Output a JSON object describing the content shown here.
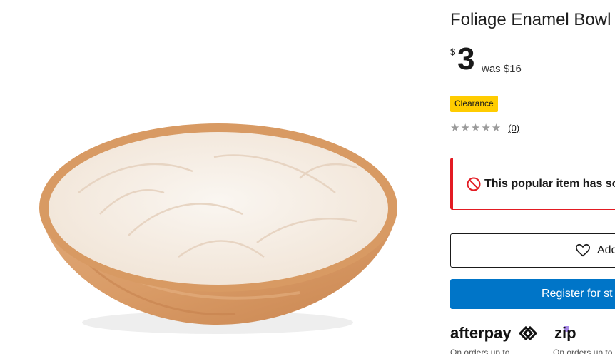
{
  "product": {
    "title": "Foliage Enamel Bowl",
    "image_alt": "product-image-foliage-enamel-bowl"
  },
  "price": {
    "currency": "$",
    "amount": "3",
    "was": "was $16"
  },
  "badge": {
    "label": "Clearance",
    "color": "#ffcc00"
  },
  "rating": {
    "stars": "★★★★★",
    "count": "(0)"
  },
  "alert": {
    "icon": "prohibited-icon",
    "text": "This popular item has so",
    "color": "#e31b23"
  },
  "wishlist": {
    "icon": "heart-icon",
    "label": "Add"
  },
  "register": {
    "label": "Register for st",
    "color": "#0075c8"
  },
  "payments": {
    "afterpay": {
      "logo_text": "afterpay",
      "note": "On orders up to"
    },
    "zip": {
      "logo_text": "zip",
      "note": "On orders up to"
    }
  }
}
